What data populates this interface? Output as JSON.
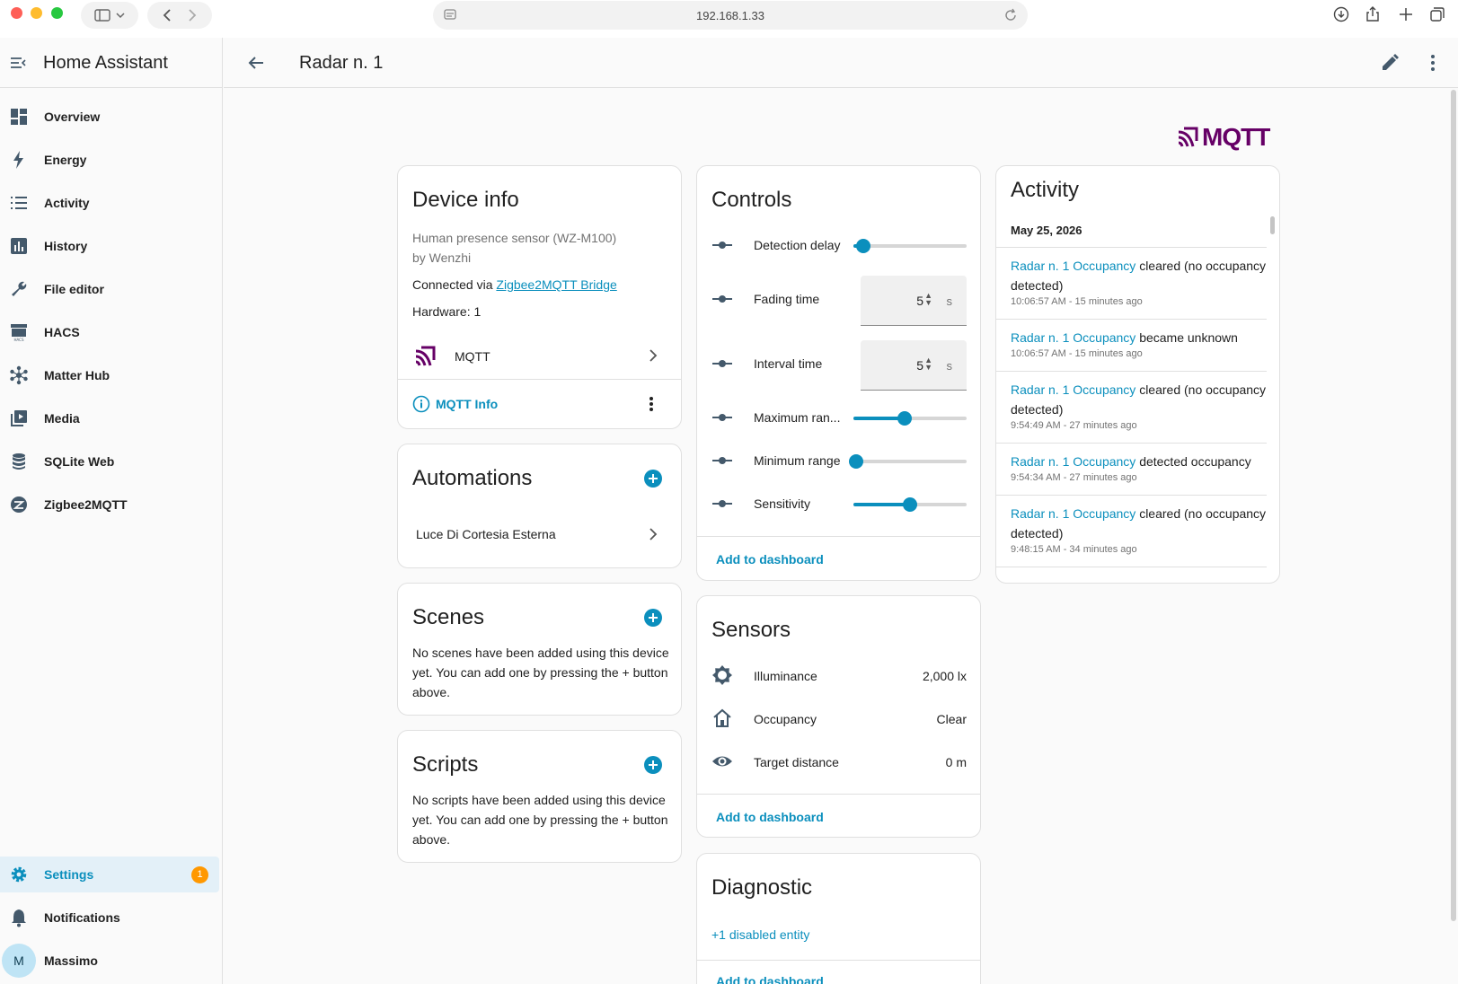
{
  "browser": {
    "url": "192.168.1.33"
  },
  "sidebar": {
    "title": "Home Assistant",
    "items": [
      {
        "label": "Overview"
      },
      {
        "label": "Energy"
      },
      {
        "label": "Activity"
      },
      {
        "label": "History"
      },
      {
        "label": "File editor"
      },
      {
        "label": "HACS"
      },
      {
        "label": "Matter Hub"
      },
      {
        "label": "Media"
      },
      {
        "label": "SQLite Web"
      },
      {
        "label": "Zigbee2MQTT"
      }
    ],
    "settings": {
      "label": "Settings",
      "badge": "1"
    },
    "notifications": {
      "label": "Notifications"
    },
    "user": {
      "label": "Massimo",
      "initial": "M"
    }
  },
  "header": {
    "title": "Radar n. 1"
  },
  "brand": {
    "logo_text": "MQTT",
    "color": "#660066"
  },
  "device_info": {
    "title": "Device info",
    "model": "Human presence sensor (WZ-M100)",
    "manufacturer": "by Wenzhi",
    "connected_prefix": "Connected via",
    "connected_link": "Zigbee2MQTT Bridge",
    "hardware": "Hardware: 1",
    "integration": "MQTT",
    "mqtt_info": "MQTT Info"
  },
  "automations": {
    "title": "Automations",
    "items": [
      "Luce Di Cortesia Esterna"
    ]
  },
  "scenes": {
    "title": "Scenes",
    "empty": "No scenes have been added using this device yet. You can add one by pressing the + button above."
  },
  "scripts": {
    "title": "Scripts",
    "empty": "No scripts have been added using this device yet. You can add one by pressing the + button above."
  },
  "controls": {
    "title": "Controls",
    "detection_delay": {
      "label": "Detection delay",
      "level": 0.09
    },
    "fading_time": {
      "label": "Fading time",
      "value": "5",
      "unit": "s"
    },
    "interval_time": {
      "label": "Interval time",
      "value": "5",
      "unit": "s"
    },
    "maximum_range": {
      "label": "Maximum ran...",
      "level": 0.45
    },
    "minimum_range": {
      "label": "Minimum range",
      "level": 0.02
    },
    "sensitivity": {
      "label": "Sensitivity",
      "level": 0.5
    },
    "add_to_dashboard": "Add to dashboard"
  },
  "sensors": {
    "title": "Sensors",
    "items": [
      {
        "label": "Illuminance",
        "value": "2,000 lx"
      },
      {
        "label": "Occupancy",
        "value": "Clear"
      },
      {
        "label": "Target distance",
        "value": "0 m"
      }
    ],
    "add_to_dashboard": "Add to dashboard"
  },
  "diagnostic": {
    "title": "Diagnostic",
    "disabled": "+1 disabled entity",
    "add_to_dashboard": "Add to dashboard"
  },
  "activity": {
    "title": "Activity",
    "date": "May 25, 2026",
    "entries": [
      {
        "entity": "Radar n. 1 Occupancy",
        "action": "cleared (no occupancy detected)",
        "time": "10:06:57 AM - 15 minutes ago"
      },
      {
        "entity": "Radar n. 1 Occupancy",
        "action": "became unknown",
        "time": "10:06:57 AM - 15 minutes ago"
      },
      {
        "entity": "Radar n. 1 Occupancy",
        "action": "cleared (no occupancy detected)",
        "time": "9:54:49 AM - 27 minutes ago"
      },
      {
        "entity": "Radar n. 1 Occupancy",
        "action": "detected occupancy",
        "time": "9:54:34 AM - 27 minutes ago"
      },
      {
        "entity": "Radar n. 1 Occupancy",
        "action": "cleared (no occupancy detected)",
        "time": "9:48:15 AM - 34 minutes ago"
      }
    ]
  },
  "colors": {
    "accent": "#0b8fbd",
    "badge": "#ff9800",
    "icon": "#44596b"
  }
}
